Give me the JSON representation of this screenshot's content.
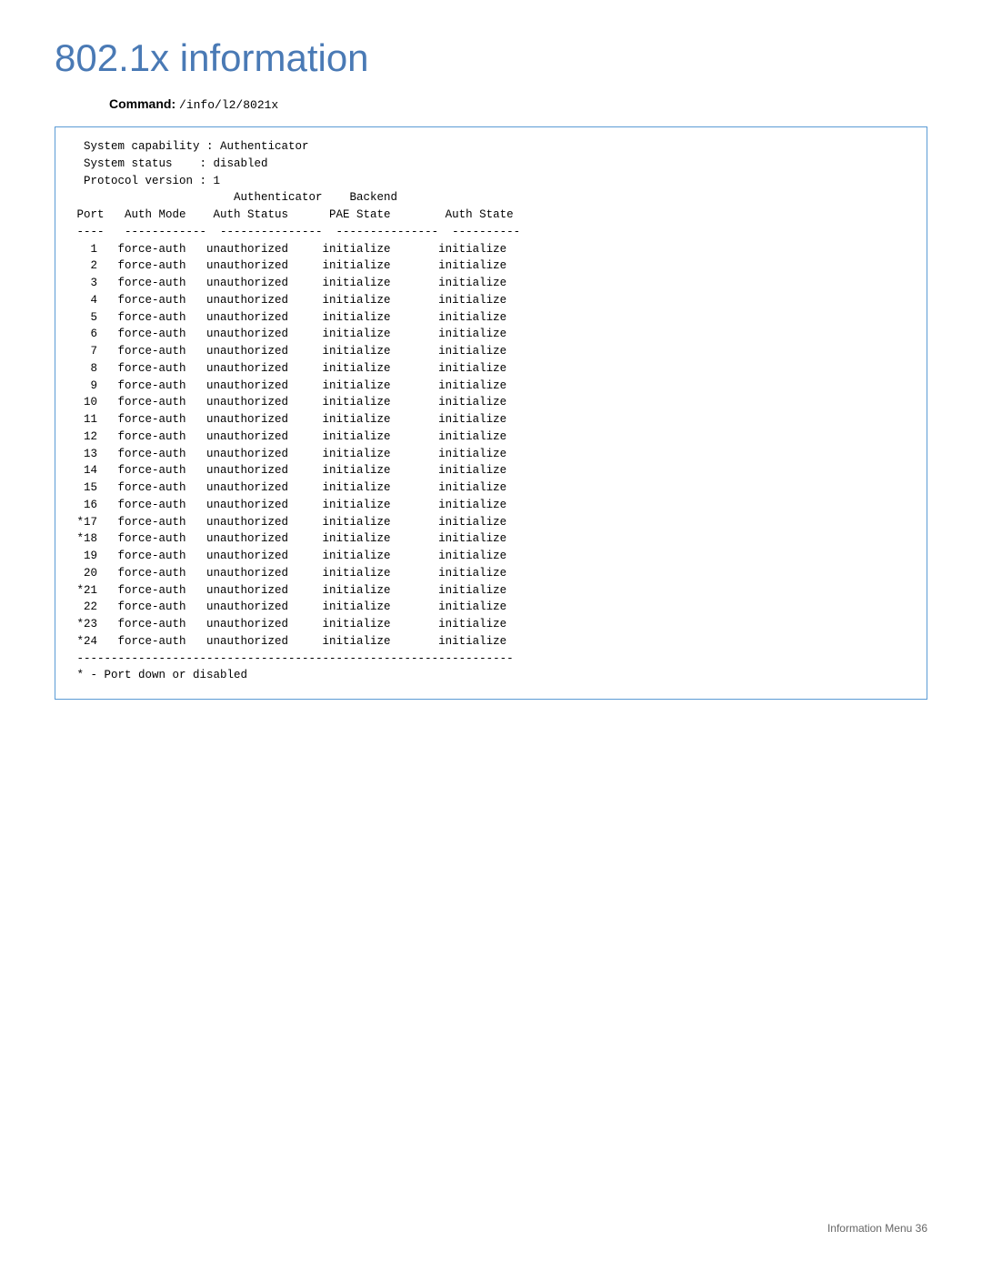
{
  "page": {
    "title": "802.1x information",
    "command_label": "Command:",
    "command_value": "/info/l2/8021x"
  },
  "terminal": {
    "system_info": [
      "System capability : Authenticator",
      "System status    : disabled",
      "Protocol version : 1"
    ],
    "header": "                        Authenticator    Backend",
    "columns": " Port   Auth Mode    Auth Status      PAE State        Auth State",
    "separator": " ----   ------------  ---------------  ---------------  ----------",
    "rows": [
      {
        " port": "  1",
        "auth_mode": "force-auth",
        "auth_status": "unauthorized",
        "pae_state": "initialize",
        "backend": "initialize"
      },
      {
        " port": "  2",
        "auth_mode": "force-auth",
        "auth_status": "unauthorized",
        "pae_state": "initialize",
        "backend": "initialize"
      },
      {
        " port": "  3",
        "auth_mode": "force-auth",
        "auth_status": "unauthorized",
        "pae_state": "initialize",
        "backend": "initialize"
      },
      {
        " port": "  4",
        "auth_mode": "force-auth",
        "auth_status": "unauthorized",
        "pae_state": "initialize",
        "backend": "initialize"
      },
      {
        " port": "  5",
        "auth_mode": "force-auth",
        "auth_status": "unauthorized",
        "pae_state": "initialize",
        "backend": "initialize"
      },
      {
        " port": "  6",
        "auth_mode": "force-auth",
        "auth_status": "unauthorized",
        "pae_state": "initialize",
        "backend": "initialize"
      },
      {
        " port": "  7",
        "auth_mode": "force-auth",
        "auth_status": "unauthorized",
        "pae_state": "initialize",
        "backend": "initialize"
      },
      {
        " port": "  8",
        "auth_mode": "force-auth",
        "auth_status": "unauthorized",
        "pae_state": "initialize",
        "backend": "initialize"
      },
      {
        " port": "  9",
        "auth_mode": "force-auth",
        "auth_status": "unauthorized",
        "pae_state": "initialize",
        "backend": "initialize"
      },
      {
        " port": " 10",
        "auth_mode": "force-auth",
        "auth_status": "unauthorized",
        "pae_state": "initialize",
        "backend": "initialize"
      },
      {
        " port": " 11",
        "auth_mode": "force-auth",
        "auth_status": "unauthorized",
        "pae_state": "initialize",
        "backend": "initialize"
      },
      {
        " port": " 12",
        "auth_mode": "force-auth",
        "auth_status": "unauthorized",
        "pae_state": "initialize",
        "backend": "initialize"
      },
      {
        " port": " 13",
        "auth_mode": "force-auth",
        "auth_status": "unauthorized",
        "pae_state": "initialize",
        "backend": "initialize"
      },
      {
        " port": " 14",
        "auth_mode": "force-auth",
        "auth_status": "unauthorized",
        "pae_state": "initialize",
        "backend": "initialize"
      },
      {
        " port": " 15",
        "auth_mode": "force-auth",
        "auth_status": "unauthorized",
        "pae_state": "initialize",
        "backend": "initialize"
      },
      {
        " port": " 16",
        "auth_mode": "force-auth",
        "auth_status": "unauthorized",
        "pae_state": "initialize",
        "backend": "initialize"
      },
      {
        " port": "*17",
        "auth_mode": "force-auth",
        "auth_status": "unauthorized",
        "pae_state": "initialize",
        "backend": "initialize"
      },
      {
        " port": "*18",
        "auth_mode": "force-auth",
        "auth_status": "unauthorized",
        "pae_state": "initialize",
        "backend": "initialize"
      },
      {
        " port": " 19",
        "auth_mode": "force-auth",
        "auth_status": "unauthorized",
        "pae_state": "initialize",
        "backend": "initialize"
      },
      {
        " port": " 20",
        "auth_mode": "force-auth",
        "auth_status": "unauthorized",
        "pae_state": "initialize",
        "backend": "initialize"
      },
      {
        " port": "*21",
        "auth_mode": "force-auth",
        "auth_status": "unauthorized",
        "pae_state": "initialize",
        "backend": "initialize"
      },
      {
        " port": " 22",
        "auth_mode": "force-auth",
        "auth_status": "unauthorized",
        "pae_state": "initialize",
        "backend": "initialize"
      },
      {
        " port": "*23",
        "auth_mode": "force-auth",
        "auth_status": "unauthorized",
        "pae_state": "initialize",
        "backend": "initialize"
      },
      {
        " port": "*24",
        "auth_mode": "force-auth",
        "auth_status": "unauthorized",
        "pae_state": "initialize",
        "backend": "initialize"
      }
    ],
    "footer_separator": "----------------------------------------------------------------",
    "footnote": "* - Port down or disabled"
  },
  "footer": {
    "text": "Information Menu   36"
  }
}
